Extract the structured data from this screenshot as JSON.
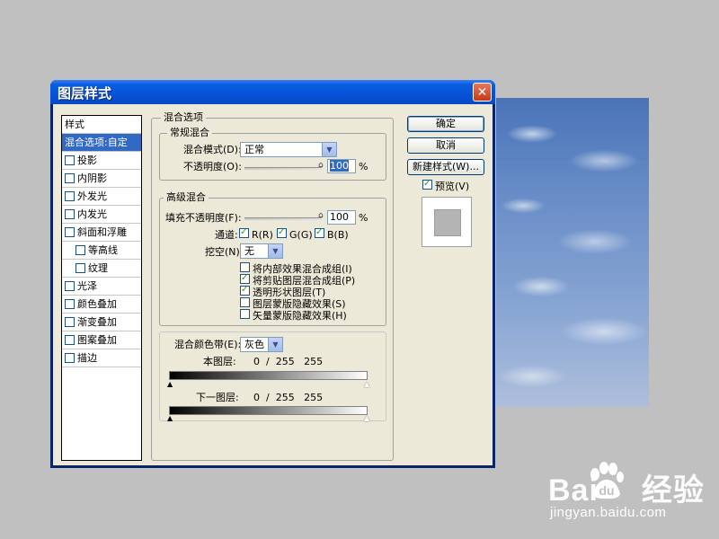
{
  "dialog": {
    "title": "图层样式",
    "close": "✕"
  },
  "styles": {
    "header": "样式",
    "items": [
      {
        "label": "混合选项:自定",
        "selected": true,
        "checkbox": false
      },
      {
        "label": "投影",
        "checkbox": true
      },
      {
        "label": "内阴影",
        "checkbox": true
      },
      {
        "label": "外发光",
        "checkbox": true
      },
      {
        "label": "内发光",
        "checkbox": true
      },
      {
        "label": "斜面和浮雕",
        "checkbox": true
      },
      {
        "label": "等高线",
        "checkbox": true,
        "indent": true
      },
      {
        "label": "纹理",
        "checkbox": true,
        "indent": true
      },
      {
        "label": "光泽",
        "checkbox": true
      },
      {
        "label": "颜色叠加",
        "checkbox": true
      },
      {
        "label": "渐变叠加",
        "checkbox": true
      },
      {
        "label": "图案叠加",
        "checkbox": true
      },
      {
        "label": "描边",
        "checkbox": true
      }
    ]
  },
  "blending": {
    "title": "混合选项",
    "general": {
      "title": "常规混合",
      "mode_label": "混合模式(D):",
      "mode_value": "正常",
      "opacity_label": "不透明度(O):",
      "opacity_value": "100",
      "unit": "%"
    },
    "advanced": {
      "title": "高级混合",
      "fill_label": "填充不透明度(F):",
      "fill_value": "100",
      "unit": "%",
      "channels_label": "通道:",
      "channel_r": "R(R)",
      "channel_g": "G(G)",
      "channel_b": "B(B)",
      "knockout_label": "挖空(N):",
      "knockout_value": "无",
      "options": [
        {
          "label": "将内部效果混合成组(I)",
          "checked": false
        },
        {
          "label": "将剪贴图层混合成组(P)",
          "checked": true
        },
        {
          "label": "透明形状图层(T)",
          "checked": true
        },
        {
          "label": "图层蒙版隐藏效果(S)",
          "checked": false
        },
        {
          "label": "矢量蒙版隐藏效果(H)",
          "checked": false
        }
      ]
    },
    "blendif": {
      "label": "混合颜色带(E):",
      "value": "灰色",
      "this_layer_label": "本图层:",
      "this_layer_values": "0  /  255   255",
      "under_layer_label": "下一图层:",
      "under_layer_values": "0  /  255   255"
    }
  },
  "buttons": {
    "ok": "确定",
    "cancel": "取消",
    "new_style": "新建样式(W)...",
    "preview": "预览(V)"
  },
  "watermark": {
    "logo": "Bai",
    "suffix": "经验",
    "url": "jingyan.baidu.com"
  }
}
